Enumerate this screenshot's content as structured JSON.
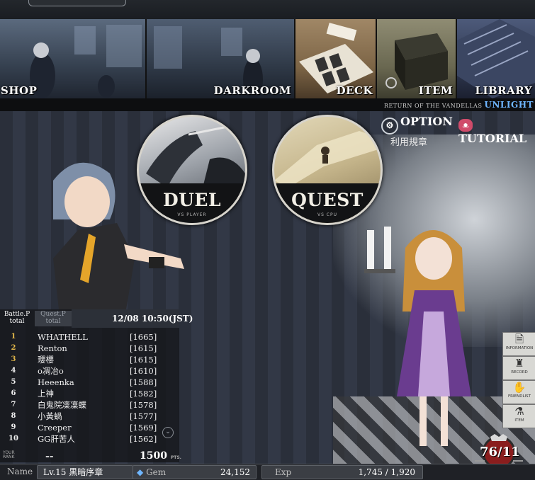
{
  "top": {
    "button_label": ""
  },
  "nav": {
    "shop": "SHOP",
    "darkroom": "DARKROOM",
    "deck": "DECK",
    "item": "ITEM",
    "library": "LIBRARY",
    "tagline": "RETURN OF THE VANDELLAS",
    "brand": "UNLIGHT"
  },
  "modes": {
    "duel": {
      "title": "DUEL",
      "sub": "VS PLAYER"
    },
    "quest": {
      "title": "QUEST",
      "sub": "VS CPU"
    }
  },
  "links": {
    "option": "OPTION",
    "tutorial": "TUTORIAL",
    "terms": "利用規章"
  },
  "ranking": {
    "tab_battle": "Battle.P total",
    "tab_quest": "Quest.P total",
    "time": "12/08 10:50(JST)",
    "rows": [
      {
        "rank": "1",
        "name": "WHATHELL",
        "points": "[1665]"
      },
      {
        "rank": "2",
        "name": "Renton",
        "points": "[1615]"
      },
      {
        "rank": "3",
        "name": "瓔櫻",
        "points": "[1615]"
      },
      {
        "rank": "4",
        "name": "o凋冶o",
        "points": "[1610]"
      },
      {
        "rank": "5",
        "name": "Heeenka",
        "points": "[1588]"
      },
      {
        "rank": "6",
        "name": "上神",
        "points": "[1582]"
      },
      {
        "rank": "7",
        "name": "白鬼院凜凜蝶",
        "points": "[1578]"
      },
      {
        "rank": "8",
        "name": "小黃蝸",
        "points": "[1577]"
      },
      {
        "rank": "9",
        "name": "Creeper",
        "points": "[1569]"
      },
      {
        "rank": "10",
        "name": "GG肝苦人",
        "points": "[1562]"
      }
    ],
    "your_rank_label": "YOUR RANK",
    "your_rank_value": "--",
    "your_points": "1500",
    "pts_label": "PTS."
  },
  "side": {
    "information": "INFORMATION",
    "record": "RECORD",
    "friendlist": "FRIENDLIST",
    "item": "ITEM"
  },
  "emblem": {
    "text": "76/11",
    "stars": "★★★"
  },
  "status": {
    "name_label": "Name",
    "name_value": "Lv.15 黒暗序章",
    "gem_label": "Gem",
    "gem_value": "24,152",
    "exp_label": "Exp",
    "exp_value": "1,745 / 1,920"
  },
  "icons": {
    "option": "gear-icon",
    "tutorial": "mascot-face-icon",
    "gem": "gem-icon"
  }
}
